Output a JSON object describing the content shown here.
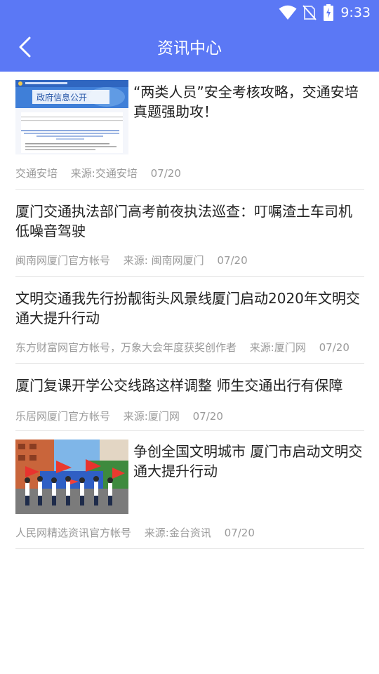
{
  "status_bar": {
    "time": "9:33",
    "icons": [
      "wifi-icon",
      "no-sim-icon",
      "battery-charging-icon"
    ]
  },
  "app_bar": {
    "title": "资讯中心",
    "back_icon": "chevron-left-icon"
  },
  "colors": {
    "primary": "#5b78f5",
    "title_text": "#222222",
    "meta_text": "#9a9a9a",
    "divider": "#e6e6e6"
  },
  "news": [
    {
      "title": "“两类人员”安全考核攻略，交通安培真题强助攻！",
      "author": "交通安培",
      "source": "来源:交通安培",
      "date": "07/20",
      "thumbnail": "government-info-disclosure-document",
      "thumbnail_text": "政府信息公开"
    },
    {
      "title": "厦门交通执法部门高考前夜执法巡查：叮嘱渣土车司机 低噪音驾驶",
      "author": "闽南网厦门官方帐号",
      "source": "来源: 闽南网厦门",
      "date": "07/20"
    },
    {
      "title": "文明交通我先行扮靓街头风景线厦门启动2020年文明交通大提升行动",
      "author": "东方财富网官方帐号，万象大会年度获奖创作者",
      "source": "来源:厦门网",
      "date": "07/20"
    },
    {
      "title": "厦门复课开学公交线路这样调整 师生交通出行有保障",
      "author": "乐居网厦门官方帐号",
      "source": "来源:厦门网",
      "date": "07/20"
    },
    {
      "title": "争创全国文明城市 厦门市启动文明交通大提升行动",
      "author": "人民网精选资讯官方帐号",
      "source": "来源:金台资讯",
      "date": "07/20",
      "thumbnail": "flag-waving-ceremony-photo"
    }
  ]
}
